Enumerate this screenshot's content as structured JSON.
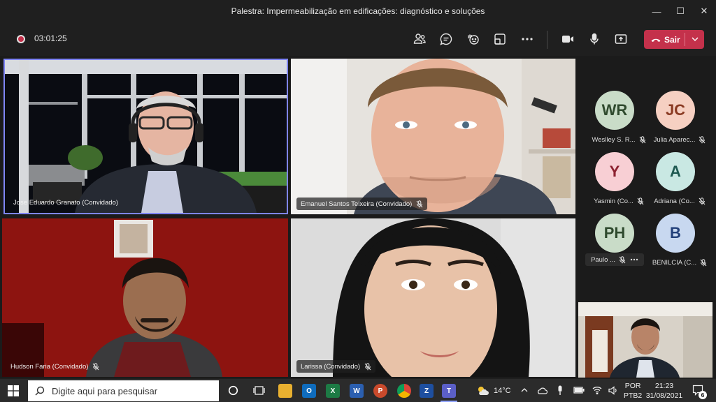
{
  "window": {
    "title": "Palestra: Impermeabilização em edificações: diagnóstico e soluções"
  },
  "toolbar": {
    "timer": "03:01:25",
    "leave_label": "Sair"
  },
  "participants": [
    {
      "name": "Jose Eduardo Granato (Convidado)",
      "muted": false
    },
    {
      "name": "Emanuel Santos Teixeira (Convidado)",
      "muted": true
    },
    {
      "name": "Hudson Faria (Convidado)",
      "muted": true
    },
    {
      "name": "Larissa (Convidado)",
      "muted": true
    }
  ],
  "roster": [
    {
      "initials": "WR",
      "name": "Weslley S. R...",
      "bg": "#c9dcc8",
      "fg": "#2f4a2e"
    },
    {
      "initials": "JC",
      "name": "Julia Aparec...",
      "bg": "#f6d0c2",
      "fg": "#8a3a22"
    },
    {
      "initials": "Y",
      "name": "Yasmin (Co...",
      "bg": "#f8cfd4",
      "fg": "#8c2230"
    },
    {
      "initials": "A",
      "name": "Adriana (Co...",
      "bg": "#c9e8e3",
      "fg": "#1f5a52"
    },
    {
      "initials": "PH",
      "name": "Paulo ...",
      "bg": "#c9dcc8",
      "fg": "#2f4a2e"
    },
    {
      "initials": "B",
      "name": "BENILCIA (C...",
      "bg": "#c8d8f0",
      "fg": "#22407a"
    }
  ],
  "taskbar": {
    "search_placeholder": "Digite aqui para pesquisar",
    "weather": "14°C",
    "lang_top": "POR",
    "lang_bottom": "PTB2",
    "time": "21:23",
    "date": "31/08/2021",
    "notifications": "6"
  }
}
